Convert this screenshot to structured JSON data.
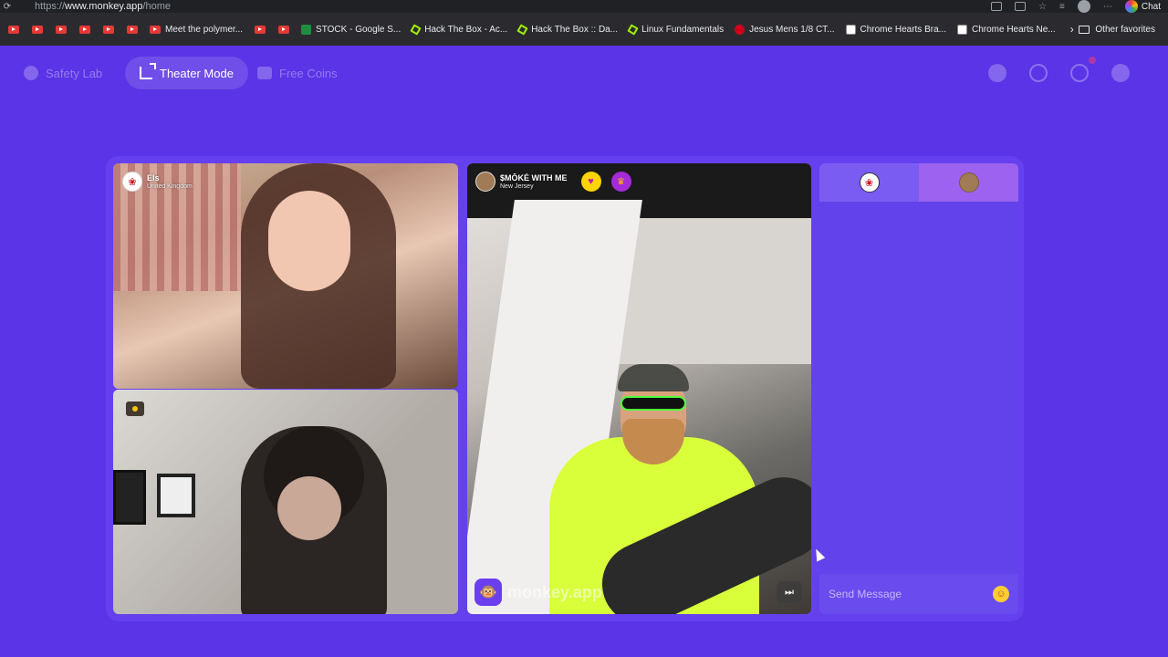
{
  "browser": {
    "url_prefix": "https://",
    "url_host": "www.monkey.app",
    "url_path": "/home",
    "chat_label": "Chat"
  },
  "bookmarks": {
    "items": [
      {
        "icon": "youtube-icon",
        "label": ""
      },
      {
        "icon": "youtube-icon",
        "label": ""
      },
      {
        "icon": "youtube-icon",
        "label": ""
      },
      {
        "icon": "youtube-icon",
        "label": ""
      },
      {
        "icon": "youtube-icon",
        "label": ""
      },
      {
        "icon": "youtube-icon",
        "label": ""
      },
      {
        "icon": "youtube-icon",
        "label": "Meet the polymer..."
      },
      {
        "icon": "youtube-icon",
        "label": ""
      },
      {
        "icon": "youtube-icon",
        "label": ""
      },
      {
        "icon": "sheets-icon",
        "label": "STOCK - Google S..."
      },
      {
        "icon": "hackthebox-icon",
        "label": "Hack The Box - Ac..."
      },
      {
        "icon": "hackthebox-icon",
        "label": "Hack The Box :: Da..."
      },
      {
        "icon": "hackthebox-icon",
        "label": "Linux Fundamentals"
      },
      {
        "icon": "jcpenney-icon",
        "label": "Jesus Mens 1/8 CT..."
      },
      {
        "icon": "chrome-hearts-icon",
        "label": "Chrome Hearts Bra..."
      },
      {
        "icon": "chrome-hearts-icon",
        "label": "Chrome Hearts Ne..."
      }
    ],
    "other_label": "Other favorites"
  },
  "topbar": {
    "safety_lab": "Safety Lab",
    "theater_mode": "Theater Mode",
    "free_coins": "Free Coins"
  },
  "tiles": {
    "top_left": {
      "name": "Els",
      "location": "United Kingdom"
    },
    "center": {
      "name": "$MŌKĖ WITH ME",
      "location": "New Jersey"
    }
  },
  "watermark": {
    "text": "monkey.app"
  },
  "chat": {
    "placeholder": "Send Message"
  },
  "colors": {
    "background": "#5a34e6",
    "panel": "#6242ea",
    "accent": "#9d62f0"
  }
}
